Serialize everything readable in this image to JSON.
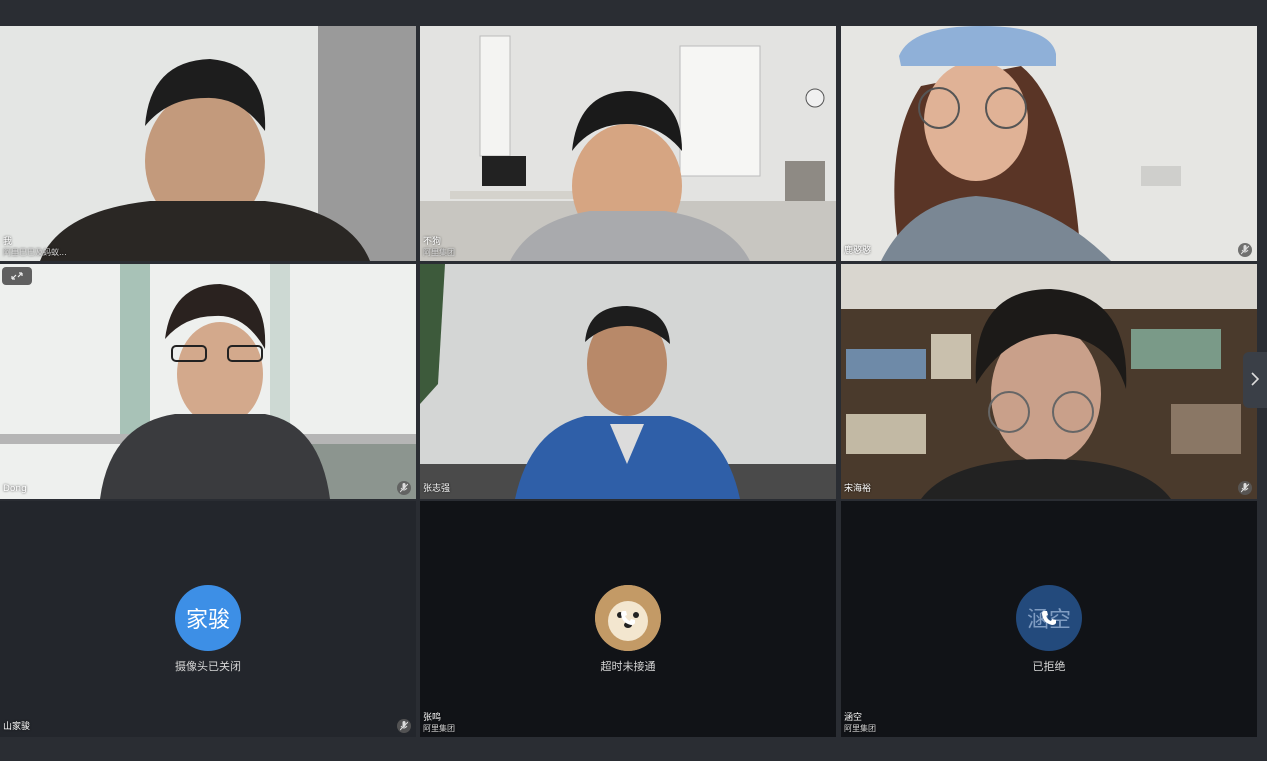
{
  "participants": [
    {
      "name": "我",
      "org": "阿里巴巴及蚂蚁..."
    },
    {
      "name": "不狗",
      "org": "阿里集团"
    },
    {
      "name": "鹿憨憨",
      "org": ""
    },
    {
      "name": "Dong",
      "org": ""
    },
    {
      "name": "张志强",
      "org": ""
    },
    {
      "name": "宋海裕",
      "org": ""
    },
    {
      "name": "山家骏",
      "org": "",
      "avatar_text": "家骏",
      "status": "摄像头已关闭"
    },
    {
      "name": "张鸣",
      "org": "阿里集团",
      "status": "超时未接通"
    },
    {
      "name": "涵空",
      "org": "阿里集团",
      "avatar_text": "涵空",
      "status": "已拒绝"
    }
  ],
  "icons": {
    "mic_muted": "mic-muted-icon",
    "expand": "expand-icon",
    "next_page": "chevron-right-icon",
    "phone": "phone-icon"
  },
  "colors": {
    "background": "#2a2d33",
    "avatar_blue": "#3d8fe6",
    "avatar_dark_blue": "#234a7c"
  }
}
